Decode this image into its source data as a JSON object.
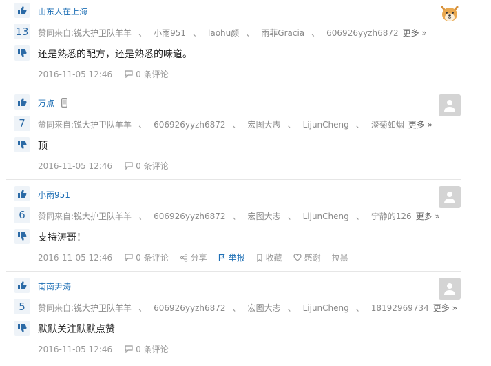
{
  "colors": {
    "accent": "#1e6fb5",
    "muted": "#999999",
    "vote_bg": "#eef3f8"
  },
  "answers": [
    {
      "author": "山东人在上海",
      "votes": "13",
      "voters_label": "赞同来自:",
      "voters": [
        "锐大护卫队羊羊",
        "小雨951",
        "laohu颜",
        "雨菲Gracia",
        "606926yyzh6872"
      ],
      "more": "更多 »",
      "content": "还是熟悉的配方，还是熟悉的味道。",
      "date": "2016-11-05 12:46",
      "comments": "0 条评论",
      "avatar": "shiba-dog-avatar"
    },
    {
      "author": "万点",
      "device": "mobile-icon",
      "votes": "7",
      "voters_label": "赞同来自:",
      "voters": [
        "锐大护卫队羊羊",
        "606926yyzh6872",
        "宏图大志",
        "LijunCheng",
        "淡菊如烟"
      ],
      "more": "更多 »",
      "content": "顶",
      "date": "2016-11-05 12:46",
      "comments": "0 条评论",
      "avatar": "default-avatar"
    },
    {
      "author": "小雨951",
      "votes": "6",
      "voters_label": "赞同来自:",
      "voters": [
        "锐大护卫队羊羊",
        "606926yyzh6872",
        "宏图大志",
        "LijunCheng",
        "宁静的126"
      ],
      "more": "更多 »",
      "content": "支持涛哥！",
      "date": "2016-11-05 12:46",
      "comments": "0 条评论",
      "actions": {
        "share": "分享",
        "report": "举报",
        "favorite": "收藏",
        "thanks": "感谢",
        "block": "拉黑"
      },
      "avatar": "default-avatar"
    },
    {
      "author": "南南尹涛",
      "votes": "5",
      "voters_label": "赞同来自:",
      "voters": [
        "锐大护卫队羊羊",
        "606926yyzh6872",
        "宏图大志",
        "LijunCheng",
        "18192969734"
      ],
      "more": "更多 »",
      "content": "默默关注默默点赞",
      "date": "2016-11-05 12:46",
      "comments": "0 条评论",
      "avatar": "default-avatar"
    }
  ]
}
